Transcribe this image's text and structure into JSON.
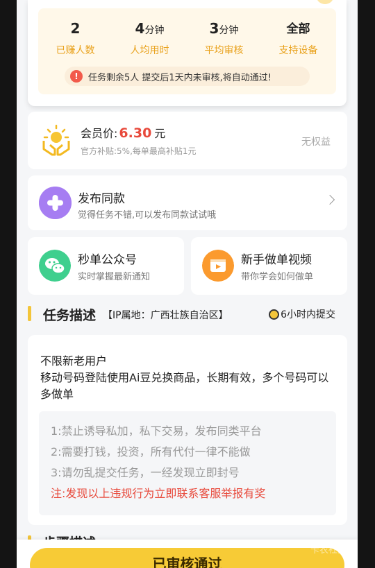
{
  "stats": [
    {
      "value": "2",
      "unit": "",
      "label": "已赚人数"
    },
    {
      "value": "4",
      "unit": "分钟",
      "label": "人均用时"
    },
    {
      "value": "3",
      "unit": "分钟",
      "label": "平均审核"
    },
    {
      "value": "全部",
      "unit": "",
      "label": "支持设备"
    }
  ],
  "notice": {
    "icon": "!",
    "text": "任务剩余5人   提交后1天内未审核,将自动通过!"
  },
  "member": {
    "price_label": "会员价:",
    "price_value": "6.30",
    "price_unit": "元",
    "subsidy": "官方补贴:5%,每单最高补贴1元",
    "rights": "无权益"
  },
  "publish": {
    "title": "发布同款",
    "desc": "觉得任务不错,可以发布同款试试哦"
  },
  "quick_cards": [
    {
      "title": "秒单公众号",
      "desc": "实时掌握最新通知",
      "color": "#3fcf8e"
    },
    {
      "title": "新手做单视频",
      "desc": "带你学会如何做单",
      "color": "#fb9a2e"
    }
  ],
  "task_section": {
    "title": "任务描述",
    "ip": "【IP属地：广西壮族自治区】",
    "deadline": "6小时内提交"
  },
  "description": {
    "line1": "不限新老用户",
    "line2": "移动号码登陆使用Ai豆兑换商品，长期有效，多个号码可以多做单"
  },
  "rules": [
    "1:禁止诱导私加，私下交易，发布同类平台",
    "2:需要打钱，投资，所有代付一律不能做",
    "3:请勿乱提交任务，一经发现立即封号"
  ],
  "warning": "注:发现以上违规行为立即联系客服举报有奖",
  "steps_section": {
    "title": "步骤描述"
  },
  "approve_button": "已审核通过",
  "watermark": "卡农社区"
}
